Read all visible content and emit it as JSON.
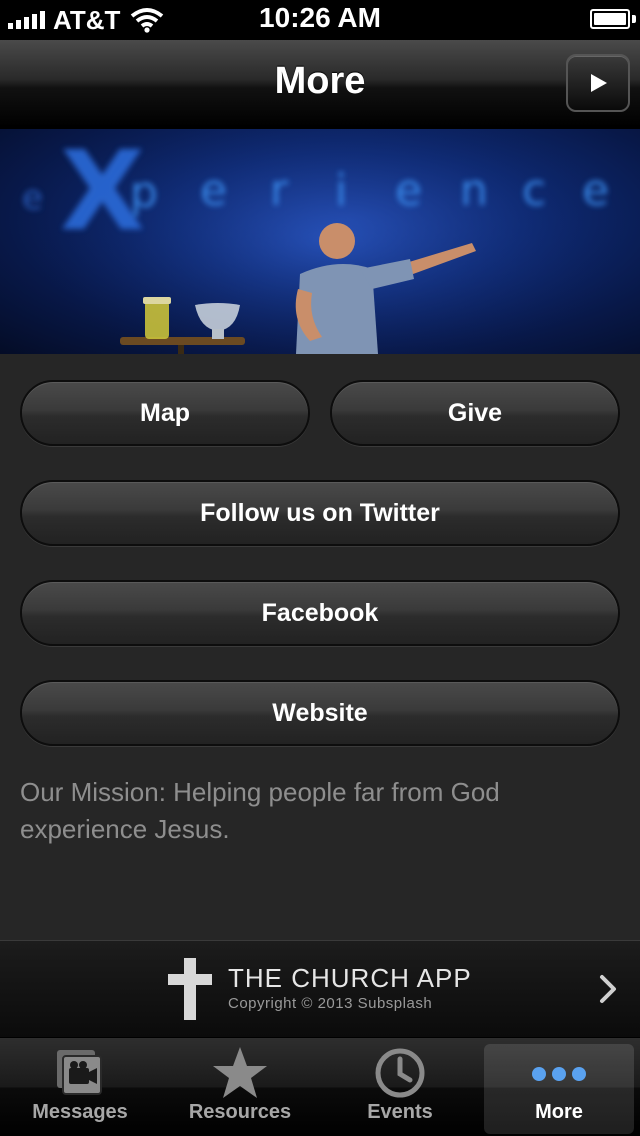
{
  "status_bar": {
    "carrier": "AT&T",
    "time": "10:26 AM"
  },
  "nav": {
    "title": "More",
    "play_icon": "play-icon"
  },
  "banner": {
    "image": "church-stage-photo",
    "stage_text": "eXperience"
  },
  "buttons": {
    "map": "Map",
    "give": "Give",
    "twitter": "Follow us on Twitter",
    "facebook": "Facebook",
    "website": "Website"
  },
  "mission": {
    "text": "Our Mission:  Helping people far from God experience Jesus."
  },
  "footer": {
    "title": "THE CHURCH APP",
    "copyright": "Copyright © 2013 Subsplash"
  },
  "tabs": [
    {
      "label": "Messages",
      "icon": "messages-icon",
      "active": false
    },
    {
      "label": "Resources",
      "icon": "star-icon",
      "active": false
    },
    {
      "label": "Events",
      "icon": "clock-icon",
      "active": false
    },
    {
      "label": "More",
      "icon": "more-dots-icon",
      "active": true
    }
  ],
  "colors": {
    "background": "#262626",
    "mission_text": "#8e8e8e",
    "tab_active_dots": "#4a90e2"
  }
}
